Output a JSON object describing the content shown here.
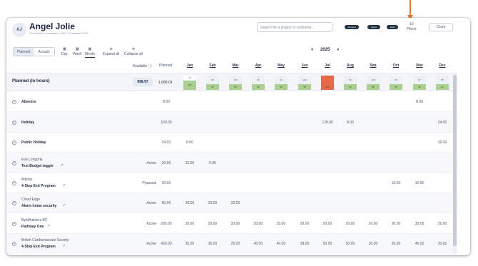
{
  "header": {
    "avatar": "AJ",
    "name": "Angel Jolie",
    "roles": "Consultant, Consultant UX/CI, Consultant EVP",
    "search_placeholder": "Search for a project or customer...",
    "pills": [
      "Planned",
      "Active",
      "Draft"
    ],
    "filters_count": "10",
    "filters_label": "Filters",
    "close_label": "Close"
  },
  "toolbar": {
    "toggle": [
      "Planned",
      "Actuals"
    ],
    "views": [
      "Day",
      "Week",
      "Month"
    ],
    "active_view": "Month",
    "expand_all": "Expand all",
    "collapse_all": "Collapse all",
    "year": "2025",
    "prev": "«",
    "next": "»"
  },
  "columns": {
    "available": "Available",
    "planned": "Planned",
    "months": [
      "Jan",
      "Feb",
      "Mar",
      "Apr",
      "May",
      "Jun",
      "Jul",
      "Aug",
      "Sep",
      "Oct",
      "Nov",
      "Dec"
    ]
  },
  "planned_row": {
    "label": "Planned (in hours)",
    "available": "998.97",
    "planned": "1,089.03",
    "cells": [
      {
        "top": "33",
        "bottom": "182"
      },
      {
        "top": "80",
        "bottom": "80"
      },
      {
        "top": "100",
        "bottom": "80"
      },
      {
        "top": "96",
        "bottom": "80"
      },
      {
        "top": "96",
        "bottom": "80"
      },
      {
        "top": "120",
        "bottom": "80"
      },
      {
        "top": "",
        "bottom": "115"
      },
      {
        "top": "90",
        "bottom": "96"
      },
      {
        "top": "126",
        "bottom": "80"
      },
      {
        "top": "59",
        "bottom": "80"
      },
      {
        "top": "67",
        "bottom": "95"
      },
      {
        "top": "85",
        "bottom": "84"
      }
    ]
  },
  "rows": [
    {
      "label": "Absence",
      "status": "",
      "planned": "8.00",
      "values": [
        "",
        "",
        "",
        "",
        "",
        "",
        "",
        "",
        "",
        "",
        "8.00",
        ""
      ]
    },
    {
      "label": "Holiday",
      "status": "",
      "planned": "160.00",
      "values": [
        "",
        "",
        "",
        "",
        "",
        "",
        "128.00",
        "8.00",
        "",
        "",
        "",
        "24.00"
      ]
    },
    {
      "label": "Public Holiday",
      "status": "",
      "planned": "24.03",
      "values": [
        "8.00",
        "",
        "",
        "",
        "",
        "",
        "",
        "",
        "",
        "",
        "",
        "16.00"
      ]
    },
    {
      "customer": "Eva Longoria",
      "label": "Test Budget toggle",
      "status": "Active",
      "planned": "20.00",
      "values": [
        "15.00",
        "5.00",
        "",
        "",
        "",
        "",
        "",
        "",
        "",
        "",
        "",
        ""
      ]
    },
    {
      "customer": "Adidas",
      "label": "4-Step Exit Program",
      "status": "Proposal",
      "planned": "20.00",
      "values": [
        "",
        "",
        "",
        "",
        "",
        "",
        "",
        "",
        "",
        "10.00",
        "10.00",
        ""
      ]
    },
    {
      "customer": "Cloud Edge",
      "label": "Alarm home security",
      "status": "Active",
      "planned": "60.00",
      "values": [
        "20.00",
        "20.00",
        "20.00",
        "",
        "",
        "",
        "",
        "",
        "",
        "",
        "",
        ""
      ]
    },
    {
      "customer": "ByteBuilders BV",
      "label": "Pathway One",
      "status": "Active",
      "planned": "265.00",
      "values": [
        "20.00",
        "20.00",
        "20.00",
        "20.00",
        "20.00",
        "20.00",
        "20.00",
        "20.00",
        "20.00",
        "30.00",
        "30.00",
        "25.00"
      ]
    },
    {
      "customer": "British Cardiovascular Society",
      "label": "4-Step Exit Program",
      "status": "Active",
      "planned": "433.00",
      "values": [
        "35.00",
        "35.00",
        "25.00",
        "40.00",
        "40.00",
        "28.00",
        "50.00",
        "50.00",
        "30.00",
        "25.00",
        "45.00",
        "30.00"
      ]
    }
  ],
  "icons": {
    "expand": "plus-circle-icon",
    "external": "external-link-icon",
    "info": "info-icon"
  }
}
